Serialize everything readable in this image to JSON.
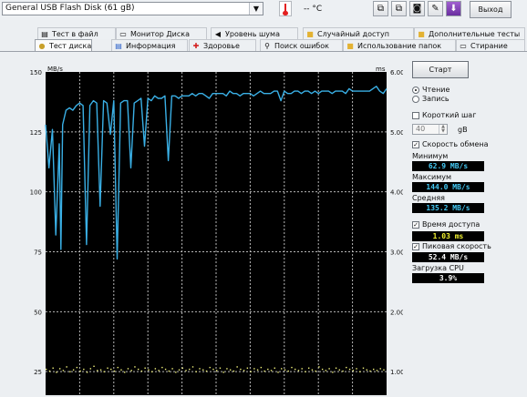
{
  "toolbar": {
    "drive": "General USB Flash Disk (61 gB)",
    "temperature": "-- °C",
    "exit_label": "Выход"
  },
  "tabs": {
    "row1": [
      {
        "label": "Тест в файл",
        "icon": "document-icon"
      },
      {
        "label": "Монитор Диска",
        "icon": "monitor-icon"
      },
      {
        "label": "Уровень шума",
        "icon": "speaker-icon"
      },
      {
        "label": "Случайный доступ",
        "icon": "folder-icon"
      },
      {
        "label": "Дополнительные тесты",
        "icon": "folder-icon"
      }
    ],
    "row2": [
      {
        "label": "Тест диска",
        "icon": "bulb-icon",
        "active": true
      },
      {
        "label": "Информация",
        "icon": "info-icon"
      },
      {
        "label": "Здоровье",
        "icon": "health-cross-icon"
      },
      {
        "label": "Поиск ошибок",
        "icon": "magnifier-icon"
      },
      {
        "label": "Использование папок",
        "icon": "folder-icon"
      },
      {
        "label": "Стирание",
        "icon": "eraser-icon"
      }
    ]
  },
  "colors": {
    "plot_background": "#000000",
    "grid": "#b8b8b8",
    "read_line": "#3ab0e6",
    "access_points": "#f0f07a"
  },
  "panel": {
    "start_label": "Старт",
    "mode_read": "Чтение",
    "mode_write": "Запись",
    "short_stroke_label": "Короткий шаг",
    "short_stroke_value": "40",
    "short_stroke_unit": "gB",
    "transfer_rate_label": "Скорость обмена",
    "minimum_label": "Минимум",
    "minimum_value": "62.9 MB/s",
    "maximum_label": "Максимум",
    "maximum_value": "144.0 MB/s",
    "average_label": "Средняя",
    "average_value": "135.2 MB/s",
    "access_time_label": "Время доступа",
    "access_time_value": "1.03 ms",
    "burst_rate_label": "Пиковая скорость",
    "burst_rate_value": "52.4 MB/s",
    "cpu_label": "Загрузка CPU",
    "cpu_value": "3.9%"
  },
  "chart_data": {
    "type": "line",
    "left_axis_unit": "MB/s",
    "right_axis_unit": "ms",
    "left_ticks": [
      "150",
      "125",
      "100",
      "75",
      "50",
      "25"
    ],
    "right_ticks": [
      "6.00",
      "5.00",
      "4.00",
      "3.00",
      "2.00",
      "1.00"
    ],
    "ylim_left": [
      0,
      150
    ],
    "ylim_right": [
      0,
      6
    ],
    "grid": true,
    "series": [
      {
        "x": [
          0,
          1,
          2,
          3,
          4,
          4.5,
          5,
          6,
          7,
          8,
          9,
          10,
          11,
          12,
          13,
          14,
          15,
          16,
          17,
          18,
          19,
          20,
          21,
          22,
          23,
          24,
          25,
          26,
          27,
          28,
          29,
          30,
          31,
          32,
          33,
          34,
          35,
          36,
          37,
          38,
          39,
          40,
          41,
          42,
          43,
          44,
          45,
          46,
          47,
          48,
          49,
          50,
          51,
          52,
          53,
          54,
          55,
          56,
          57,
          58,
          59,
          60,
          61,
          62,
          63,
          64,
          65,
          66,
          67,
          68,
          69,
          70,
          71,
          72,
          73,
          74,
          75,
          76,
          77,
          78,
          79,
          80,
          81,
          82,
          83,
          84,
          85,
          86,
          87,
          88,
          89,
          90,
          91,
          92,
          93,
          94,
          95,
          96,
          97,
          98,
          99,
          100
        ],
        "values": [
          128,
          110,
          126,
          82,
          120,
          76,
          128,
          134,
          135,
          134,
          136,
          137,
          136,
          78,
          136,
          138,
          137,
          94,
          138,
          137,
          124,
          138,
          72,
          137,
          138,
          138,
          110,
          137,
          138,
          139,
          119,
          139,
          138,
          140,
          139,
          139,
          140,
          113,
          140,
          140,
          139,
          140,
          140,
          140,
          141,
          140,
          141,
          141,
          140,
          139,
          141,
          141,
          141,
          141,
          140,
          142,
          141,
          141,
          140,
          141,
          141,
          141,
          140,
          141,
          142,
          141,
          141,
          141,
          142,
          142,
          138,
          142,
          141,
          141,
          142,
          142,
          141,
          142,
          142,
          141,
          142,
          141,
          142,
          142,
          142,
          141,
          142,
          142,
          142,
          141,
          143,
          142,
          142,
          142,
          142,
          142,
          142,
          143,
          144,
          142,
          141,
          143
        ]
      },
      {
        "x": [
          0,
          1,
          2,
          3,
          4,
          5,
          6,
          7,
          8,
          9,
          10,
          11,
          12,
          13,
          14,
          15,
          16,
          17,
          18,
          19,
          20,
          21,
          22,
          23,
          24,
          25,
          26,
          27,
          28,
          29,
          30,
          31,
          32,
          33,
          34,
          35,
          36,
          37,
          38,
          39,
          40,
          41,
          42,
          43,
          44,
          45,
          46,
          47,
          48,
          49,
          50,
          51,
          52,
          53,
          54,
          55,
          56,
          57,
          58,
          59,
          60,
          61,
          62,
          63,
          64,
          65,
          66,
          67,
          68,
          69,
          70,
          71,
          72,
          73,
          74,
          75,
          76,
          77,
          78,
          79,
          80,
          81,
          82,
          83,
          84,
          85,
          86,
          87,
          88,
          89,
          90,
          91,
          92,
          93,
          94,
          95,
          96,
          97,
          98,
          99
        ],
        "values": [
          1.05,
          1.02,
          1.07,
          1.0,
          1.06,
          1.03,
          1.09,
          1.01,
          1.04,
          1.08,
          1.02,
          1.05,
          1.0,
          1.06,
          1.1,
          1.03,
          1.04,
          1.01,
          1.07,
          1.05,
          1.02,
          1.08,
          1.04,
          1.0,
          1.06,
          1.03,
          1.09,
          1.05,
          1.02,
          1.07,
          1.04,
          1.01,
          1.06,
          1.03,
          1.08,
          1.05,
          1.02,
          1.06,
          1.0,
          1.04,
          1.07,
          1.03,
          1.05,
          1.09,
          1.01,
          1.06,
          1.04,
          1.02,
          1.08,
          1.05,
          1.03,
          1.07,
          1.0,
          1.06,
          1.04,
          1.02,
          1.09,
          1.05,
          1.03,
          1.07,
          1.01,
          1.06,
          1.04,
          1.08,
          1.02,
          1.05,
          1.03,
          1.07,
          1.0,
          1.06,
          1.04,
          1.02,
          1.08,
          1.05,
          1.03,
          1.06,
          1.01,
          1.07,
          1.04,
          1.02,
          1.09,
          1.05,
          1.03,
          1.06,
          1.0,
          1.07,
          1.04,
          1.02,
          1.08,
          1.05,
          1.03,
          1.06,
          1.01,
          1.07,
          1.04,
          1.02,
          1.05,
          1.03,
          1.06,
          1.04
        ]
      }
    ]
  }
}
